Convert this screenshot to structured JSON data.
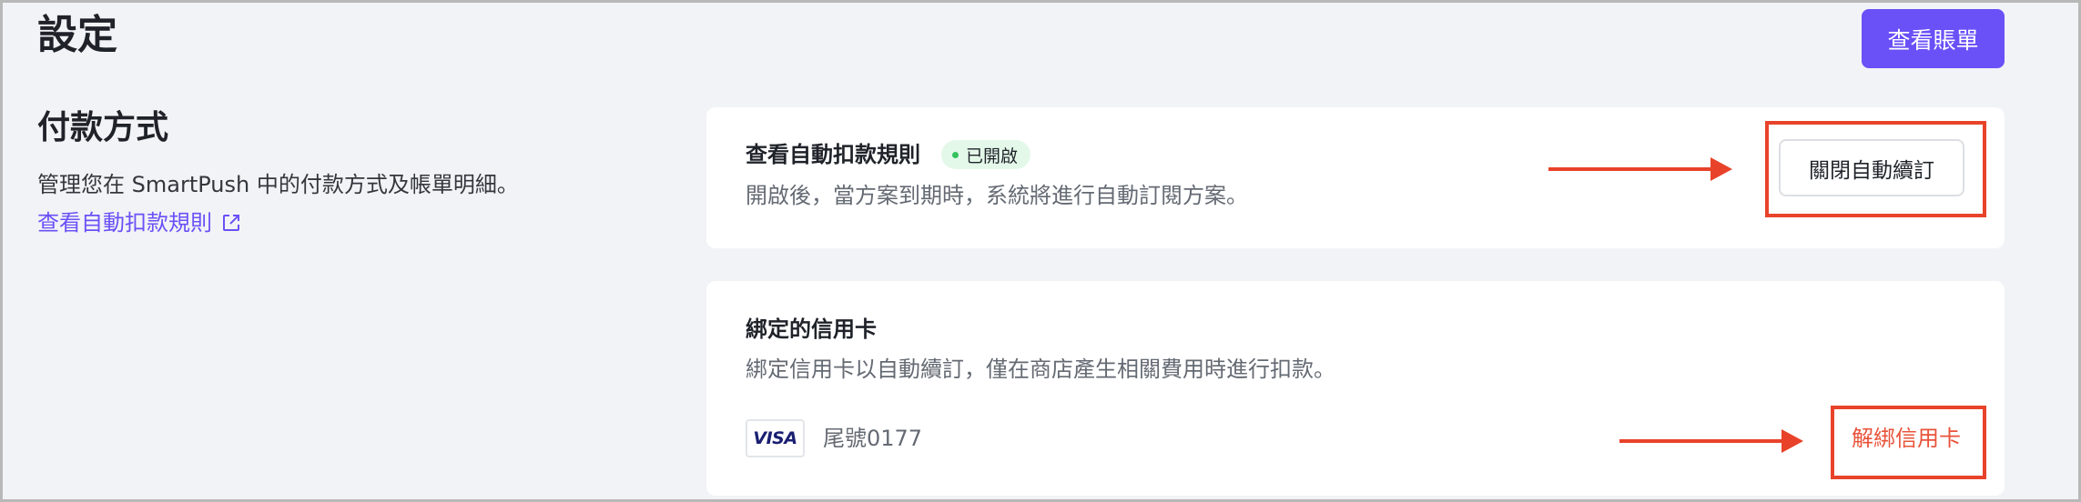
{
  "page": {
    "title": "設定"
  },
  "header": {
    "view_bill_label": "查看賬單"
  },
  "payment": {
    "title": "付款方式",
    "description": "管理您在 SmartPush 中的付款方式及帳單明細。",
    "rules_link": "查看自動扣款規則",
    "link_icon": "external-link-icon"
  },
  "auto_renew": {
    "title": "查看自動扣款規則",
    "badge": "已開啟",
    "description": "開啟後，當方案到期時，系統將進行自動訂閱方案。",
    "button_label": "關閉自動續訂"
  },
  "credit_card": {
    "title": "綁定的信用卡",
    "description": "綁定信用卡以自動續訂，僅在商店產生相關費用時進行扣款。",
    "brand": "VISA",
    "tail": "尾號0177",
    "unbind_label": "解綁信用卡"
  },
  "colors": {
    "accent": "#6a50f7",
    "badge_bg": "#e4f8ea",
    "annotation": "#e8432a",
    "danger_link": "#e8533a"
  }
}
